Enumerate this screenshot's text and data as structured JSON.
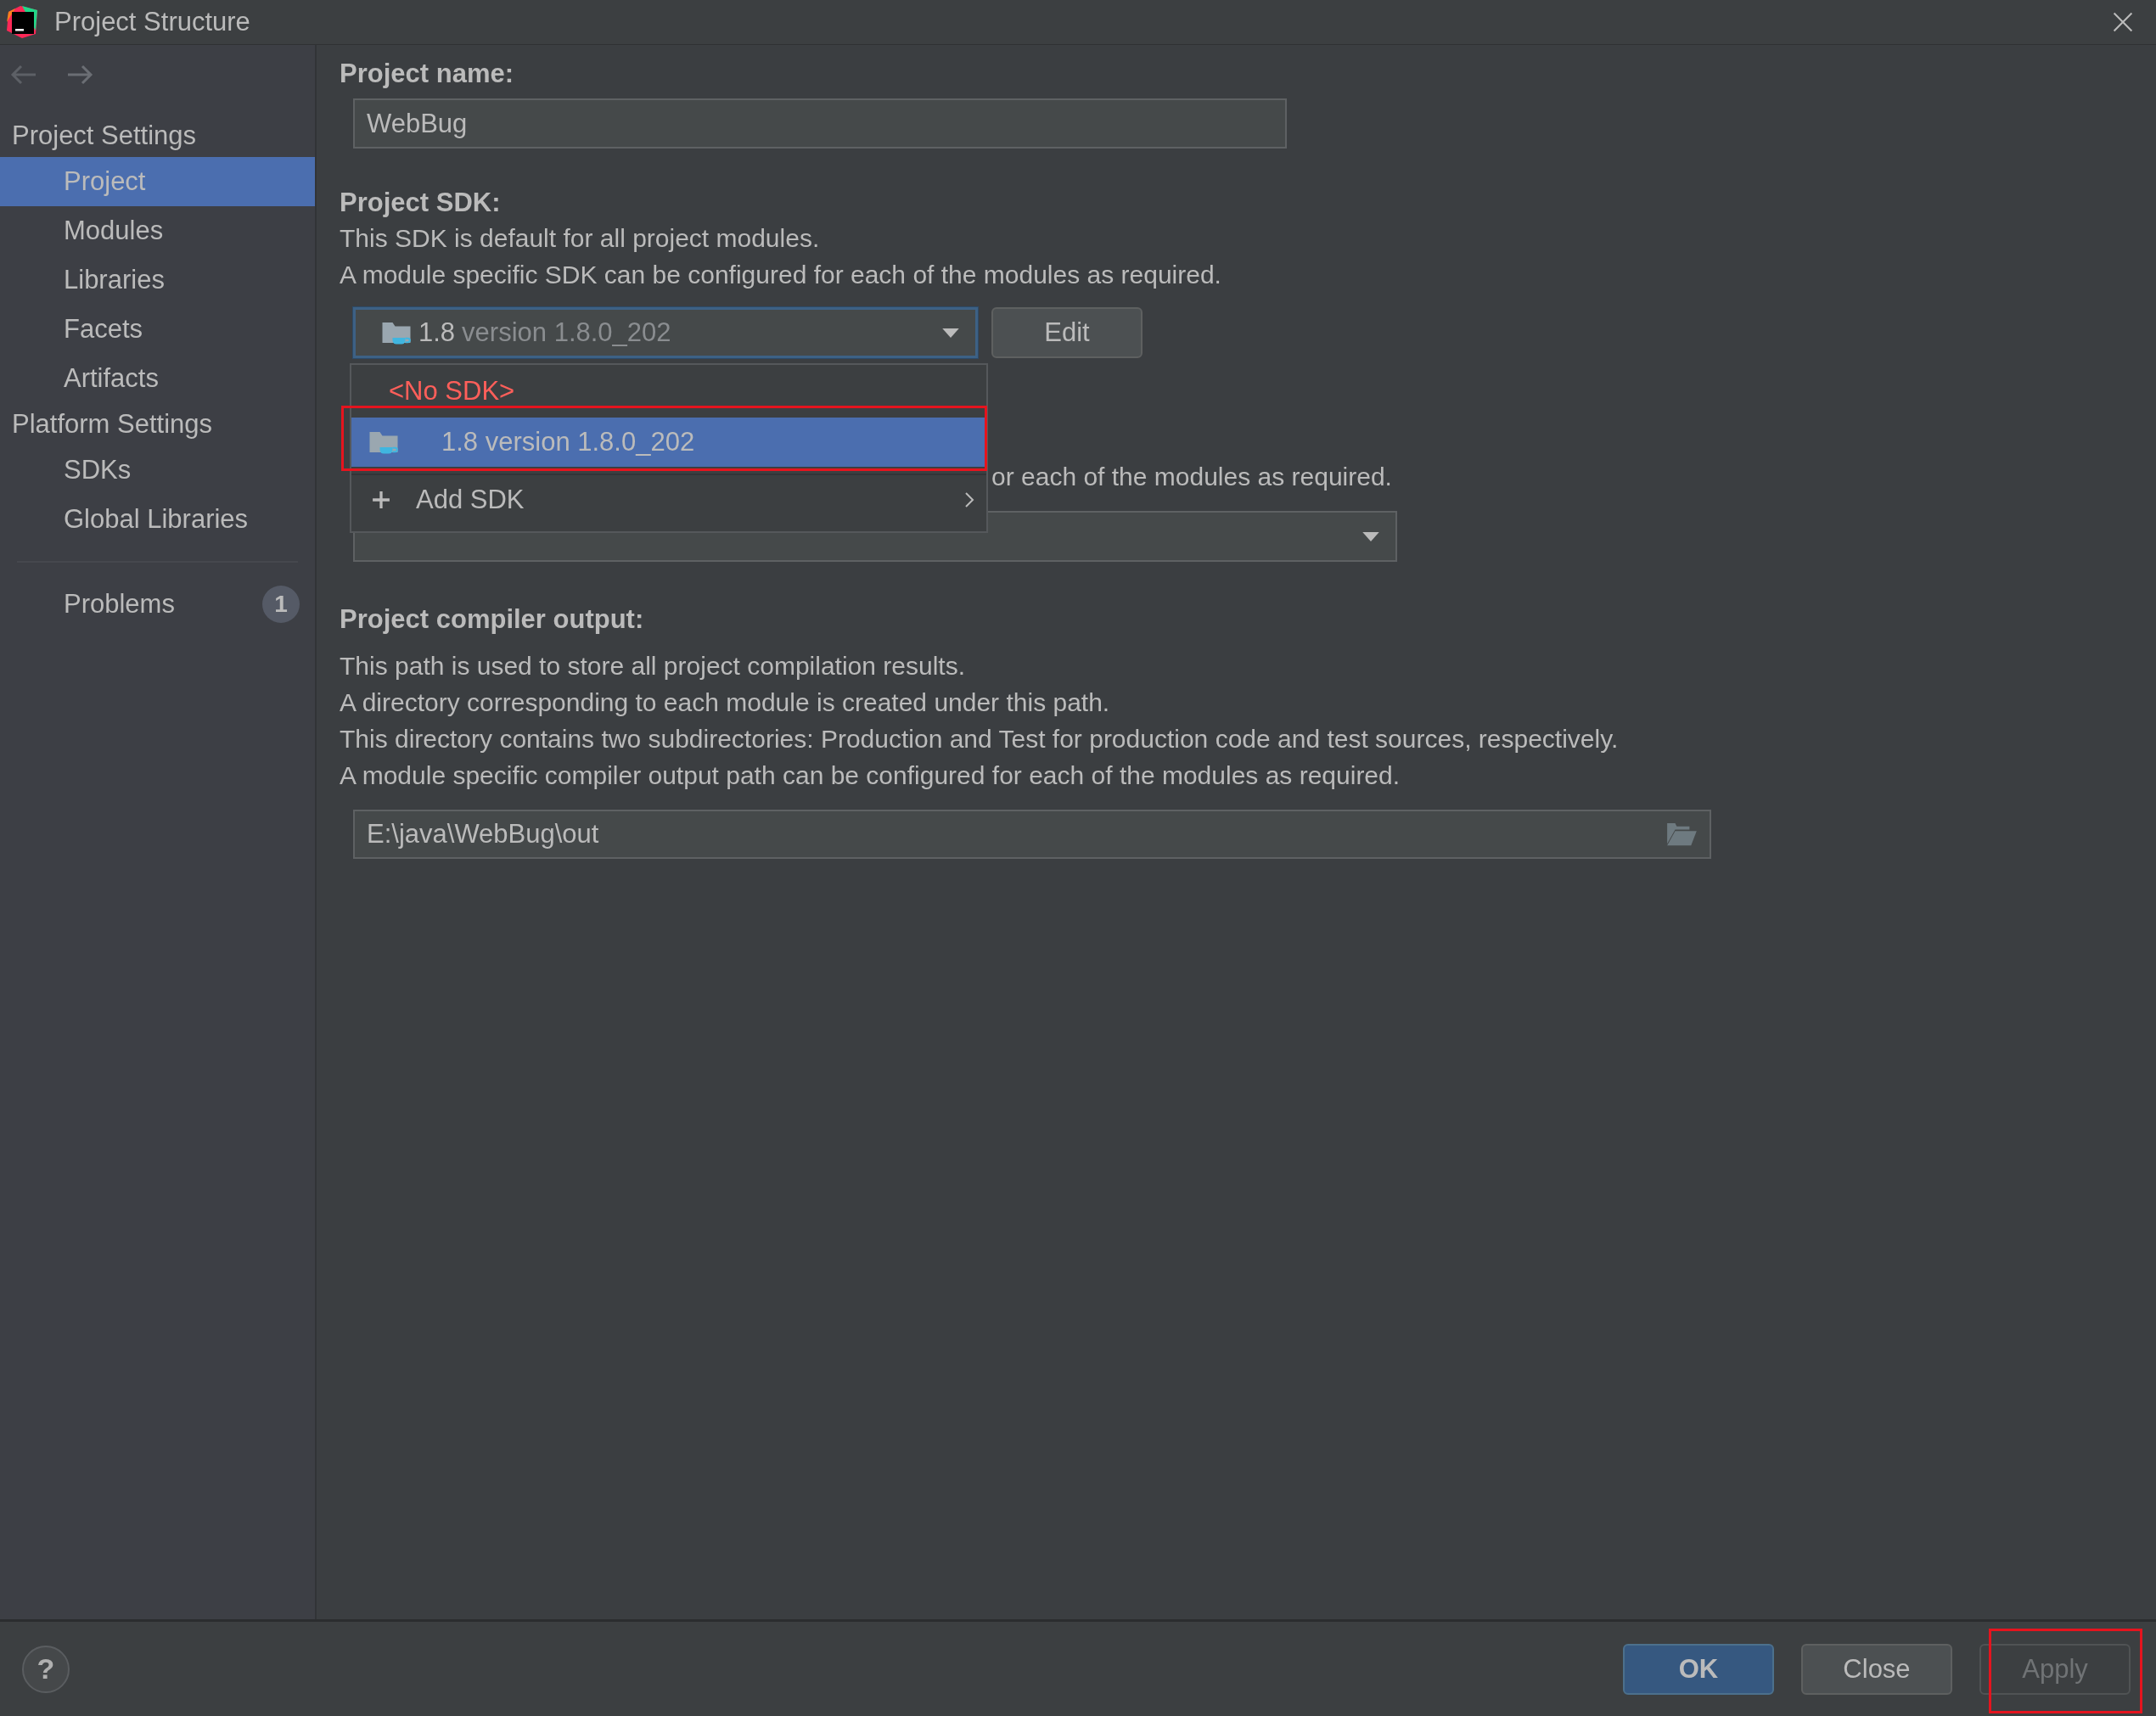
{
  "window": {
    "title": "Project Structure"
  },
  "sidebar": {
    "sections": [
      {
        "title": "Project Settings",
        "items": [
          {
            "label": "Project",
            "selected": true
          },
          {
            "label": "Modules",
            "selected": false
          },
          {
            "label": "Libraries",
            "selected": false
          },
          {
            "label": "Facets",
            "selected": false
          },
          {
            "label": "Artifacts",
            "selected": false
          }
        ]
      },
      {
        "title": "Platform Settings",
        "items": [
          {
            "label": "SDKs",
            "selected": false
          },
          {
            "label": "Global Libraries",
            "selected": false
          }
        ]
      }
    ],
    "problems": {
      "label": "Problems",
      "count": "1"
    }
  },
  "project_name": {
    "label": "Project name:",
    "value": "WebBug"
  },
  "project_sdk": {
    "label": "Project SDK:",
    "description": [
      "This SDK is default for all project modules.",
      "A module specific SDK can be configured for each of the modules as required."
    ],
    "combo": {
      "version": "1.8",
      "detail": "version 1.8.0_202"
    },
    "edit_button": "Edit",
    "popup": {
      "options": [
        {
          "kind": "none",
          "label": "<No SDK>",
          "selected": false,
          "highlighted": false
        },
        {
          "kind": "sdk",
          "label": "1.8 version 1.8.0_202",
          "selected": true,
          "highlighted": true
        },
        {
          "kind": "add",
          "label": "Add SDK",
          "selected": false,
          "highlighted": false
        }
      ]
    }
  },
  "language_level": {
    "description_fragment": "or each of the modules as required."
  },
  "compiler_output": {
    "label": "Project compiler output:",
    "description": [
      "This path is used to store all project compilation results.",
      "A directory corresponding to each module is created under this path.",
      "This directory contains two subdirectories: Production and Test for production code and test sources, respectively.",
      "A module specific compiler output path can be configured for each of the modules as required."
    ],
    "path": "E:\\java\\WebBug\\out"
  },
  "footer": {
    "help": "?",
    "buttons": [
      {
        "label": "OK",
        "kind": "default",
        "disabled": false,
        "highlighted": false
      },
      {
        "label": "Close",
        "kind": "normal",
        "disabled": false,
        "highlighted": false
      },
      {
        "label": "Apply",
        "kind": "normal",
        "disabled": true,
        "highlighted": true
      }
    ]
  }
}
